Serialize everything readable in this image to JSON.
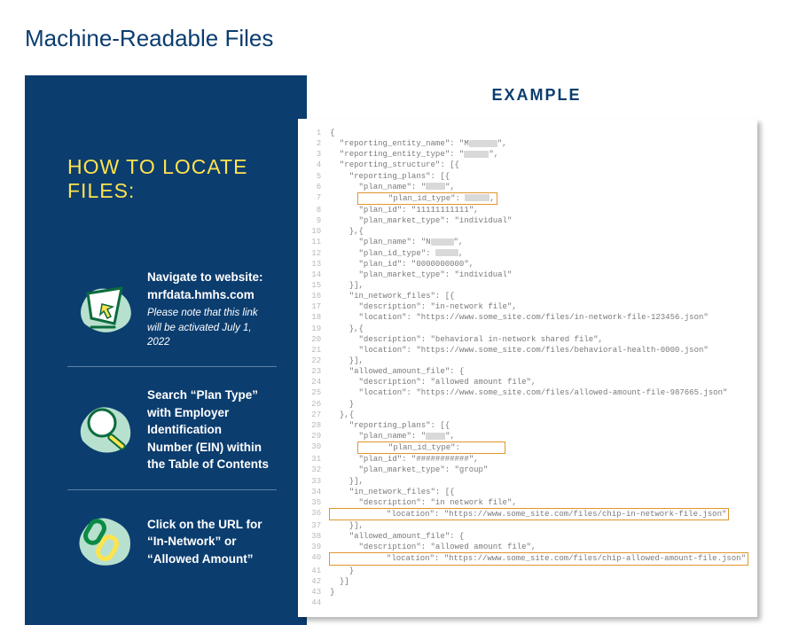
{
  "title": "Machine-Readable Files",
  "left": {
    "heading": "HOW TO LOCATE FILES:",
    "step1_bold": "Navigate to website: mrfdata.hmhs.com",
    "step1_note": "Please note that this link will be activated July 1, 2022",
    "step2": "Search “Plan Type” with Employer Identification Number (EIN) within the Table of Contents",
    "step3": "Click on the URL for “In-Network” or “Allowed Amount”"
  },
  "right": {
    "label": "EXAMPLE",
    "code": {
      "l1": "{",
      "l2a": "  \"reporting_entity_name\": \"M",
      "l2b": "\",",
      "l3a": "  \"reporting_entity_type\": \"",
      "l3b": "\",",
      "l4": "  \"reporting_structure\": [{",
      "l5": "    \"reporting_plans\": [{",
      "l6a": "      \"plan_name\": \"",
      "l6b": "\",",
      "l7a": "      \"plan_id_type\": ",
      "l7b": ",",
      "l8": "      \"plan_id\": \"11111111111\",",
      "l9": "      \"plan_market_type\": \"individual\"",
      "l10": "    },{",
      "l11a": "      \"plan_name\": \"N",
      "l11b": "\",",
      "l12a": "      \"plan_id_type\": ",
      "l12b": ",",
      "l13": "      \"plan_id\": \"0000000000\",",
      "l14": "      \"plan_market_type\": \"individual\"",
      "l15": "    }],",
      "l16": "    \"in_network_files\": [{",
      "l17": "      \"description\": \"in-network file\",",
      "l18": "      \"location\": \"https://www.some_site.com/files/in-network-file-123456.json\"",
      "l19": "    },{",
      "l20": "      \"description\": \"behavioral in-network shared file\",",
      "l21": "      \"location\": \"https://www.some_site.com/files/behavioral-health-0000.json\"",
      "l22": "    }],",
      "l23": "    \"allowed_amount_file\": {",
      "l24": "      \"description\": \"allowed amount file\",",
      "l25": "      \"location\": \"https://www.some_site.com/files/allowed-amount-file-987665.json\"",
      "l26": "    }",
      "l27": "  },{",
      "l28": "    \"reporting_plans\": [{",
      "l29a": "      \"plan_name\": \"",
      "l29b": "\",",
      "l30a": "      \"plan_id_type\":",
      "l30b": "",
      "l31": "      \"plan_id\": \"###########\",",
      "l32": "      \"plan_market_type\": \"group\"",
      "l33": "    }],",
      "l34": "    \"in_network_files\": [{",
      "l35": "      \"description\": \"in network file\",",
      "l36": "      \"location\": \"https://www.some_site.com/files/chip-in-network-file.json\"",
      "l37": "    }],",
      "l38": "    \"allowed_amount_file\": {",
      "l39": "      \"description\": \"allowed amount file\",",
      "l40": "      \"location\": \"https://www.some_site.com/files/chip-allowed-amount-file.json\"",
      "l41": "    }",
      "l42": "  }]",
      "l43": "}",
      "l44": " "
    }
  }
}
